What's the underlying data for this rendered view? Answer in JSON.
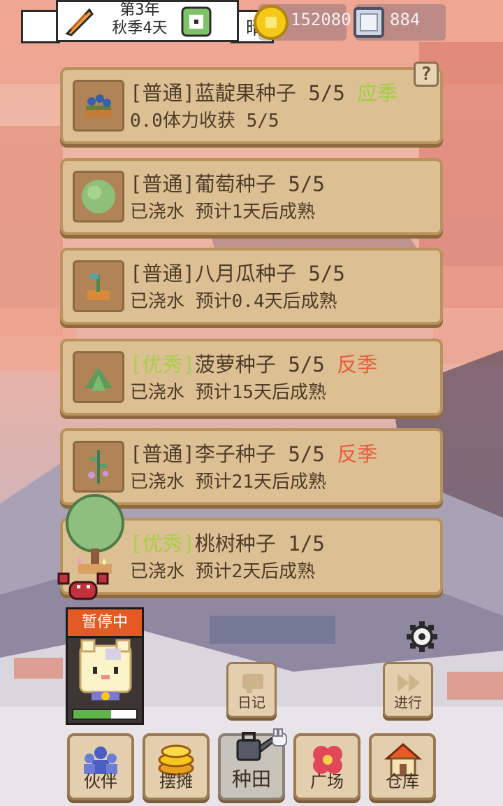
{
  "topbar": {
    "year": "第3年",
    "season_day": "秋季4天",
    "weather": "晴",
    "coins": "152080",
    "gems": "884"
  },
  "plots": [
    {
      "quality": "[普通]",
      "quality_class": "normal",
      "name": "蓝靛果种子",
      "progress": "5/5",
      "tag": "应季",
      "tag_class": "in",
      "status": "0.0体力收获 5/5",
      "icon": "blueberry-bush-icon"
    },
    {
      "quality": "[普通]",
      "quality_class": "normal",
      "name": "葡萄种子",
      "progress": "5/5",
      "tag": "",
      "tag_class": "",
      "status": "已浇水 预计1天后成熟",
      "icon": "grape-bush-icon"
    },
    {
      "quality": "[普通]",
      "quality_class": "normal",
      "name": "八月瓜种子",
      "progress": "5/5",
      "tag": "",
      "tag_class": "",
      "status": "已浇水 预计0.4天后成熟",
      "icon": "sprout-icon"
    },
    {
      "quality": "[优秀]",
      "quality_class": "good",
      "name": "菠萝种子",
      "progress": "5/5",
      "tag": "反季",
      "tag_class": "off",
      "status": "已浇水 预计15天后成熟",
      "icon": "pineapple-leaves-icon"
    },
    {
      "quality": "[普通]",
      "quality_class": "normal",
      "name": "李子种子",
      "progress": "5/5",
      "tag": "反季",
      "tag_class": "off",
      "status": "已浇水 预计21天后成熟",
      "icon": "plum-sprig-icon"
    },
    {
      "quality": "[优秀]",
      "quality_class": "good",
      "name": "桃树种子",
      "progress": "1/5",
      "tag": "",
      "tag_class": "",
      "status": "已浇水 预计2天后成熟",
      "icon": "peach-tree-icon"
    }
  ],
  "pet": {
    "status": "暂停中",
    "energy_fraction": 0.6
  },
  "controls": {
    "diary": "日记",
    "proceed": "进行"
  },
  "nav": {
    "partner": "伙伴",
    "stall": "摆摊",
    "farm": "种田",
    "plaza": "广场",
    "warehouse": "仓库"
  },
  "colors": {
    "card_bg": "#dcc093",
    "quality_good": "#a6cf4a",
    "off_season": "#e55c3d",
    "in_season": "#9ccf3e"
  }
}
